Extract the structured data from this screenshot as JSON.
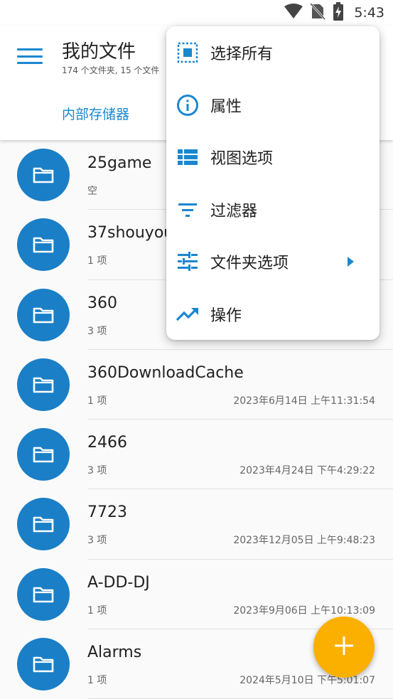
{
  "status_bar": {
    "time": "5:43",
    "icons": [
      "wifi-icon",
      "no-sim-icon",
      "battery-charging-icon"
    ]
  },
  "app_bar": {
    "title": "我的文件",
    "subtitle": "174 个文件夹, 15 个文件",
    "tab": "内部存储器",
    "menu_icon": "hamburger-menu-icon"
  },
  "accent_color": "#1a87cf",
  "folder_color": "#1a7fc6",
  "fab_color": "#fbb000",
  "files": [
    {
      "name": "25game",
      "count": "空",
      "date": ""
    },
    {
      "name": "37shouyou",
      "count": "1 项",
      "date": ""
    },
    {
      "name": "360",
      "count": "3 项",
      "date": ""
    },
    {
      "name": "360DownloadCache",
      "count": "1 项",
      "date": "2023年6月14日 上午11:31:54"
    },
    {
      "name": "2466",
      "count": "3 项",
      "date": "2023年4月24日 下午4:29:22"
    },
    {
      "name": "7723",
      "count": "3 项",
      "date": "2023年12月05日 上午9:48:23"
    },
    {
      "name": "A-DD-DJ",
      "count": "1 项",
      "date": "2023年9月06日 上午10:13:09"
    },
    {
      "name": "Alarms",
      "count": "1 项",
      "date": "2024年5月10日 下午5:01:07"
    }
  ],
  "popup_menu": {
    "items": [
      {
        "label": "选择所有",
        "icon": "select-all-icon"
      },
      {
        "label": "属性",
        "icon": "info-icon"
      },
      {
        "label": "视图选项",
        "icon": "view-list-icon"
      },
      {
        "label": "过滤器",
        "icon": "filter-icon"
      },
      {
        "label": "文件夹选项",
        "icon": "tune-icon",
        "has_submenu": true
      },
      {
        "label": "操作",
        "icon": "trending-icon"
      }
    ]
  },
  "fab": {
    "icon": "plus-icon"
  }
}
